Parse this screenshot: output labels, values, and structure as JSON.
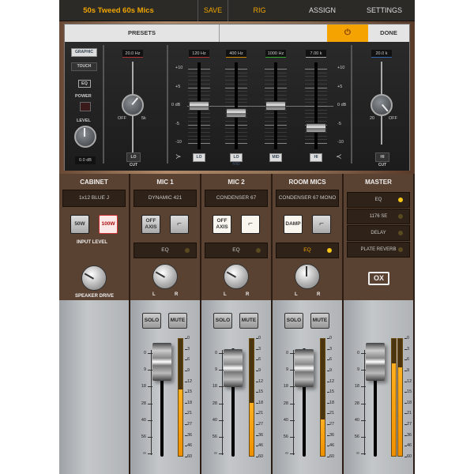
{
  "topbar": {
    "preset_name": "50s Tweed 60s Mics",
    "save": "SAVE",
    "tabs": [
      "RIG",
      "ASSIGN",
      "SETTINGS"
    ],
    "active_tab": "RIG",
    "accent": "#f0a500"
  },
  "eq": {
    "presets": "PRESETS",
    "power_icon": "power-icon",
    "done": "DONE",
    "graphic": "GRAPHIC",
    "touch": "TOUCH",
    "eq_label": "EQ",
    "power_label": "POWER",
    "level_label": "LEVEL",
    "level_value": "0.0 dB",
    "lowcut": {
      "freq": "20.0 Hz",
      "off": "OFF",
      "max": "5k",
      "button": "LO CUT"
    },
    "hicut": {
      "freq": "20.0 k",
      "min": "20",
      "off": "OFF",
      "button": "HI CUT"
    },
    "scale_left": [
      "+10",
      "+5",
      "0 dB",
      "-5",
      "-10"
    ],
    "scale_right": [
      "+10",
      "+5",
      "0 dB",
      "-5",
      "-10"
    ],
    "bands": [
      {
        "freq": "120 Hz",
        "button": "LO",
        "gain_db": 0
      },
      {
        "freq": "400 Hz",
        "button": "LO MID",
        "gain_db": -2
      },
      {
        "freq": "1000 Hz",
        "button": "MID",
        "gain_db": 0
      },
      {
        "freq": "7.00 k",
        "button": "HI",
        "gain_db": -6
      }
    ]
  },
  "mixer": {
    "cabinet": {
      "title": "CABINET",
      "model": "1x12 BLUE J",
      "b50": "50W",
      "b100": "100W",
      "input_level": "INPUT LEVEL",
      "knob_label": "SPEAKER DRIVE"
    },
    "channels": [
      {
        "title": "MIC 1",
        "model": "DYNAMIC 421",
        "left_btn": "OFF AXIS",
        "eq": "EQ",
        "eq_on": false,
        "fader_db": -5,
        "meter": 0.57
      },
      {
        "title": "MIC 2",
        "model": "CONDENSER 67",
        "left_btn": "OFF AXIS",
        "eq": "EQ",
        "eq_on": false,
        "fader_db": -9,
        "meter": 0.45
      },
      {
        "title": "ROOM MICS",
        "model": "CONDENSER 67 MONO",
        "left_btn": "DAMP",
        "eq": "EQ",
        "eq_on": true,
        "fader_db": -9,
        "meter": 0.31
      }
    ],
    "pan_l": "L",
    "pan_r": "R",
    "solo": "SOLO",
    "mute": "MUTE",
    "master": {
      "title": "MASTER",
      "effects": [
        {
          "label": "EQ",
          "on": true
        },
        {
          "label": "1176 SE",
          "on": false
        },
        {
          "label": "DELAY",
          "on": false
        },
        {
          "label": "PLATE REVERB",
          "on": false
        }
      ],
      "logo": "OX",
      "fader_db": -5,
      "meter_l": 0.79,
      "meter_r": 0.76
    },
    "fader_scale": [
      "0",
      "9",
      "18",
      "28",
      "40",
      "56",
      "∞"
    ],
    "meter_scale": [
      "0",
      "3",
      "6",
      "9",
      "12",
      "15",
      "18",
      "21",
      "27",
      "36",
      "46",
      "60"
    ]
  }
}
